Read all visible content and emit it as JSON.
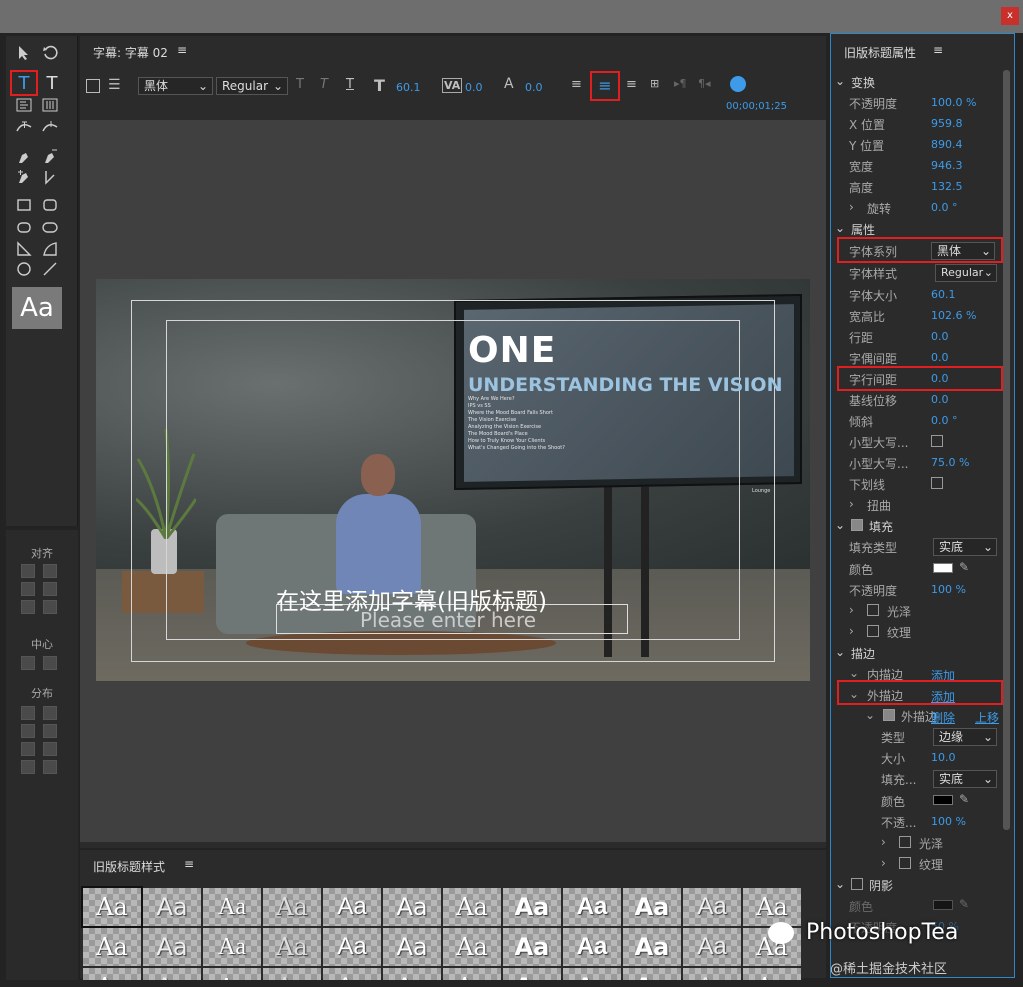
{
  "window": {
    "close_label": "x"
  },
  "editor": {
    "title": "字幕: 字幕 02",
    "menu_icon": "≡",
    "font_family": "黑体",
    "font_style": "Regular",
    "font_size": "60.1",
    "kerning": "0.0",
    "tracking": "0.0",
    "timecode": "00;00;01;25",
    "tbtn_T1": "T",
    "tbtn_T2": "T",
    "tbtn_T3": "T"
  },
  "tools": {
    "left_sections": {
      "align": "对齐",
      "center": "中心",
      "distribute": "分布"
    },
    "style_sample": "Aa"
  },
  "video": {
    "tv_title": "ONE",
    "tv_subtitle": "UNDERSTANDING THE VISION",
    "tv_list": [
      "Why Are We Here?",
      "IPS vs SS",
      "Where the Mood Board Falls Short",
      "The Vision Exercise",
      "Analyzing the Vision Exercise",
      "The Mood Board's Place",
      "How to Truly Know Your Clients",
      "What's Changed Going into the Shoot?"
    ],
    "tv_brand": "Lounge",
    "subtitle_cn": "在这里添加字幕(旧版标题)",
    "subtitle_en": "Please enter here"
  },
  "styles_panel": {
    "title": "旧版标题样式",
    "menu_icon": "≡",
    "swatch_label": "Aa"
  },
  "properties": {
    "title": "旧版标题属性",
    "menu_icon": "≡",
    "transform": "变换",
    "opacity_label": "不透明度",
    "opacity": "100.0 %",
    "xpos_label": "X 位置",
    "xpos": "959.8",
    "ypos_label": "Y 位置",
    "ypos": "890.4",
    "width_label": "宽度",
    "width": "946.3",
    "height_label": "高度",
    "height": "132.5",
    "rotation_label": "旋转",
    "rotation": "0.0 °",
    "attributes": "属性",
    "font_family_label": "字体系列",
    "font_family": "黑体",
    "font_style_label": "字体样式",
    "font_style": "Regular",
    "font_size_label": "字体大小",
    "font_size": "60.1",
    "aspect_label": "宽高比",
    "aspect": "102.6 %",
    "leading_label": "行距",
    "leading": "0.0",
    "kerning_label": "字偶间距",
    "kerning": "0.0",
    "tracking_label": "字行间距",
    "tracking": "0.0",
    "baseline_label": "基线位移",
    "baseline": "0.0",
    "slant_label": "倾斜",
    "slant": "0.0 °",
    "smallcaps_label": "小型大写...",
    "smallcaps_size_label": "小型大写...",
    "smallcaps_size": "75.0 %",
    "underline_label": "下划线",
    "distort_label": "扭曲",
    "fill": "填充",
    "fill_type_label": "填充类型",
    "fill_type": "实底",
    "color_label": "颜色",
    "fill_color": "#ffffff",
    "fill_opacity_label": "不透明度",
    "fill_opacity": "100 %",
    "sheen_label": "光泽",
    "texture_label": "纹理",
    "strokes": "描边",
    "inner_stroke_label": "内描边",
    "inner_add": "添加",
    "outer_stroke_label": "外描边",
    "outer_add": "添加",
    "outer_item_label": "外描边",
    "delete_label": "删除",
    "move_up_label": "上移",
    "type_label": "类型",
    "stroke_type": "边缘",
    "size_label": "大小",
    "stroke_size": "10.0",
    "stroke_fill_label": "填充...",
    "stroke_fill": "实底",
    "stroke_color_label": "颜色",
    "stroke_color": "#000000",
    "stroke_opacity_label": "不透...",
    "stroke_opacity": "100 %",
    "stroke_sheen_label": "光泽",
    "stroke_texture_label": "纹理",
    "shadow": "阴影",
    "shadow_color_label": "颜色",
    "shadow_color": "#000000",
    "shadow_opacity_label": "不透明度",
    "shadow_opacity": "50 %"
  },
  "watermark": {
    "brand": "PhotoshopTea",
    "community": "@稀土掘金技术社区"
  },
  "accent": {
    "blue": "#3d9be9",
    "highlight": "#e02020"
  }
}
